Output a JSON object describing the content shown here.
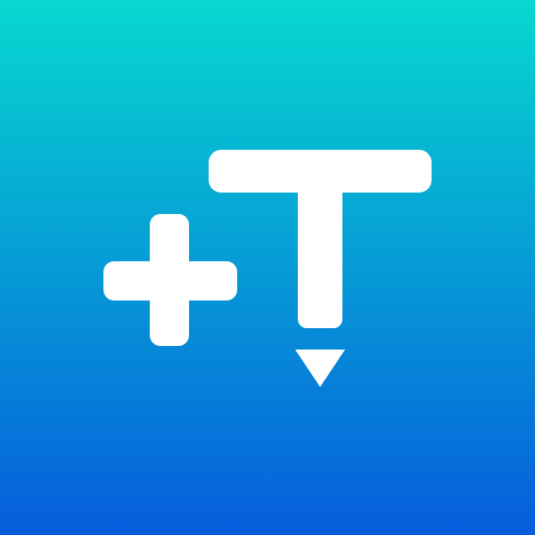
{
  "app_icon": {
    "name": "add-text-app-icon",
    "colors": {
      "gradient_top": "#07d8d0",
      "gradient_bottom": "#065ddc",
      "glyph": "#ffffff"
    },
    "icons": [
      "plus-icon",
      "text-cursor-icon"
    ]
  }
}
